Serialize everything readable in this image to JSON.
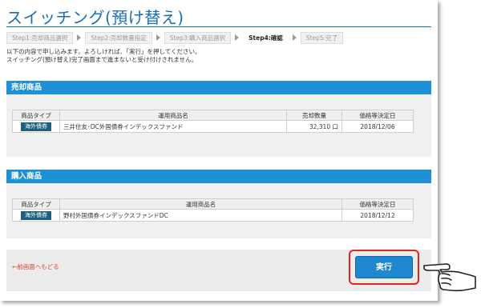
{
  "page": {
    "title": "スイッチング(預け替え)"
  },
  "steps": [
    {
      "label": "Step1:売却商品選択",
      "active": false
    },
    {
      "label": "Step2:売却数量指定",
      "active": false
    },
    {
      "label": "Step3:購入商品選択",
      "active": false
    },
    {
      "label": "Step4:確認",
      "active": true
    },
    {
      "label": "Step5:完了",
      "active": false
    }
  ],
  "instructions": {
    "line1": "以下の内容で申し込みます。よろしければ、「実行」を押してください。",
    "line2": "スイッチング(預け替え)完了画面まで進まないと受け付けされません。"
  },
  "sell": {
    "heading": "売却商品",
    "headers": {
      "type": "商品タイプ",
      "name": "運用商品名",
      "qty": "売却数量",
      "date": "価格等決定日"
    },
    "row": {
      "type": "海外債券",
      "name": "三井住友･DC外国債券インデックスファンド",
      "qty": "32,310 口",
      "date": "2018/12/06"
    }
  },
  "buy": {
    "heading": "購入商品",
    "headers": {
      "type": "商品タイプ",
      "name": "運用商品名",
      "date": "価格等決定日"
    },
    "row": {
      "type": "海外債券",
      "name": "野村外国債券インデックスファンドDC",
      "date": "2018/12/12"
    }
  },
  "footer": {
    "back_label": "←前画面へもどる",
    "exec_label": "実行"
  },
  "colors": {
    "accent": "#1e90d6",
    "title": "#1a6fb5",
    "badge": "#1f5f7e",
    "highlight_ring": "#e1261c",
    "back_link": "#e0462c"
  },
  "icons": {
    "pointer": "pointing-hand-icon"
  }
}
